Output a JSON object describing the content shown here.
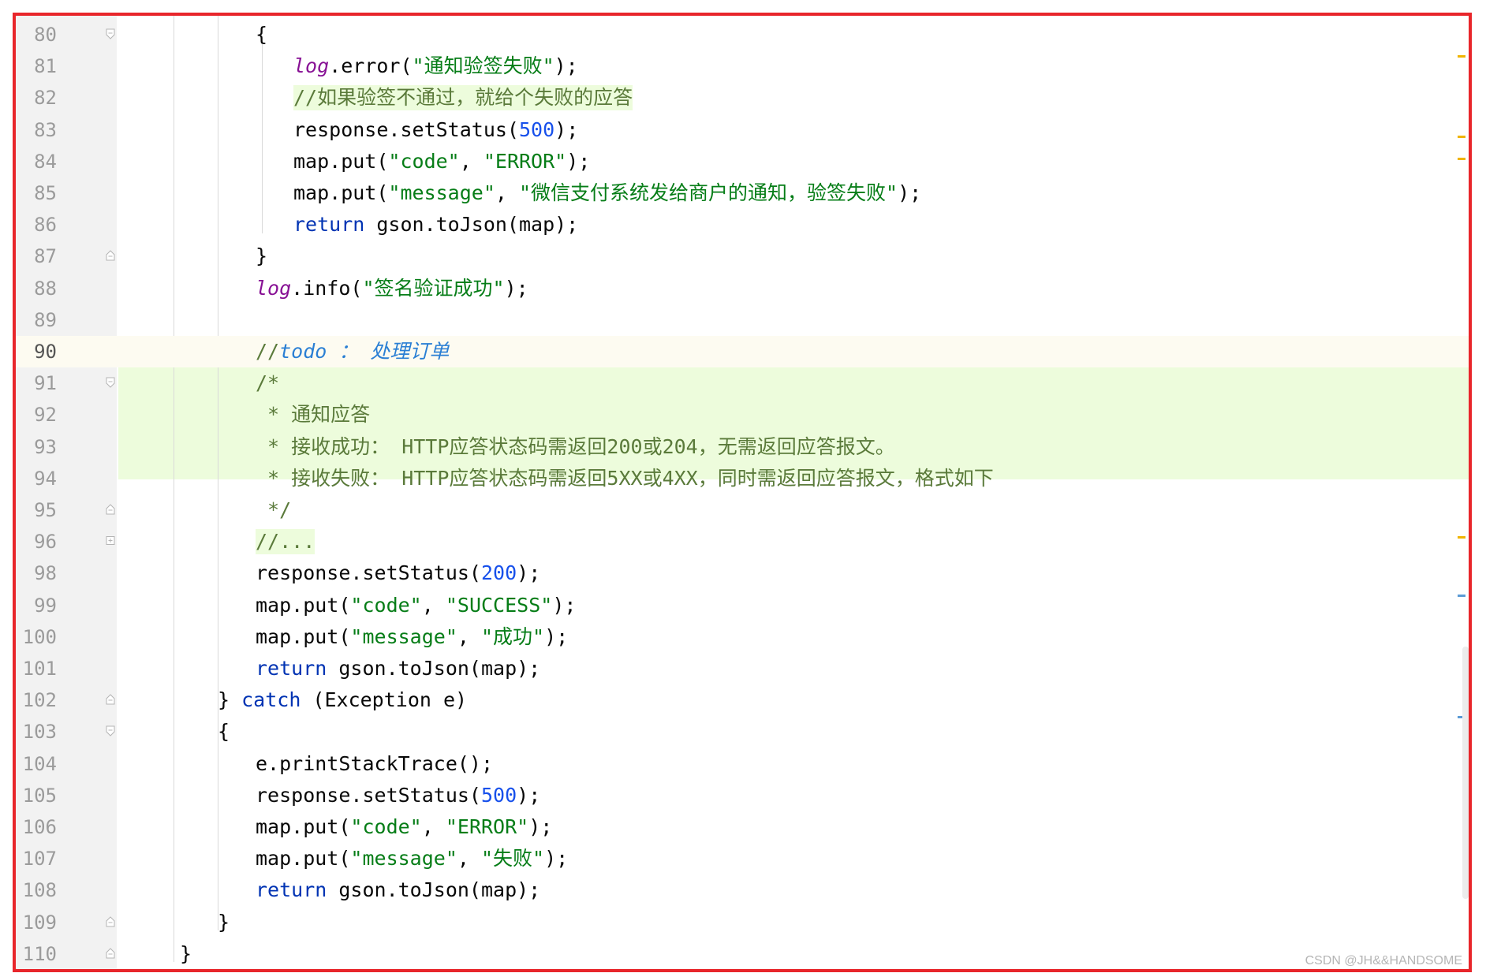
{
  "editor": {
    "lines": [
      {
        "num": "80",
        "fold": "open",
        "indent": 3,
        "tokens": [
          {
            "t": "{",
            "c": ""
          }
        ]
      },
      {
        "num": "81",
        "fold": "",
        "indent": 4,
        "tokens": [
          {
            "t": "log",
            "c": "logv"
          },
          {
            "t": ".error(",
            "c": ""
          },
          {
            "t": "\"通知验签失败\"",
            "c": "str"
          },
          {
            "t": ");",
            "c": ""
          }
        ]
      },
      {
        "num": "82",
        "fold": "",
        "indent": 4,
        "hl": true,
        "tokens": [
          {
            "t": "//如果验签不通过，就给个失败的应答",
            "c": "dcmt"
          }
        ]
      },
      {
        "num": "83",
        "fold": "",
        "indent": 4,
        "tokens": [
          {
            "t": "response.setStatus(",
            "c": ""
          },
          {
            "t": "500",
            "c": "num"
          },
          {
            "t": ");",
            "c": ""
          }
        ]
      },
      {
        "num": "84",
        "fold": "",
        "indent": 4,
        "tokens": [
          {
            "t": "map.put(",
            "c": ""
          },
          {
            "t": "\"code\"",
            "c": "str"
          },
          {
            "t": ", ",
            "c": ""
          },
          {
            "t": "\"ERROR\"",
            "c": "str"
          },
          {
            "t": ");",
            "c": ""
          }
        ]
      },
      {
        "num": "85",
        "fold": "",
        "indent": 4,
        "tokens": [
          {
            "t": "map.put(",
            "c": ""
          },
          {
            "t": "\"message\"",
            "c": "str"
          },
          {
            "t": ", ",
            "c": ""
          },
          {
            "t": "\"微信支付系统发给商户的通知，验签失败\"",
            "c": "str"
          },
          {
            "t": ");",
            "c": ""
          }
        ]
      },
      {
        "num": "86",
        "fold": "",
        "indent": 4,
        "tokens": [
          {
            "t": "return",
            "c": "kw"
          },
          {
            "t": " gson.toJson(map);",
            "c": ""
          }
        ]
      },
      {
        "num": "87",
        "fold": "close",
        "indent": 3,
        "tokens": [
          {
            "t": "}",
            "c": ""
          }
        ]
      },
      {
        "num": "88",
        "fold": "",
        "indent": 3,
        "tokens": [
          {
            "t": "log",
            "c": "logv"
          },
          {
            "t": ".info(",
            "c": ""
          },
          {
            "t": "\"签名验证成功\"",
            "c": "str"
          },
          {
            "t": ");",
            "c": ""
          }
        ]
      },
      {
        "num": "89",
        "fold": "",
        "indent": 3,
        "tokens": []
      },
      {
        "num": "90",
        "fold": "",
        "indent": 3,
        "current": true,
        "tokens": [
          {
            "t": "//",
            "c": "dcmt"
          },
          {
            "t": "todo ： 处理订单",
            "c": "todo"
          }
        ]
      },
      {
        "num": "91",
        "fold": "open",
        "indent": 3,
        "block": true,
        "tokens": [
          {
            "t": "/*",
            "c": "dcmt"
          }
        ]
      },
      {
        "num": "92",
        "fold": "",
        "indent": 3,
        "block": true,
        "tokens": [
          {
            "t": " * 通知应答",
            "c": "dcmt"
          }
        ]
      },
      {
        "num": "93",
        "fold": "",
        "indent": 3,
        "block": true,
        "tokens": [
          {
            "t": " * 接收成功： HTTP应答状态码需返回200或204，无需返回应答报文。",
            "c": "dcmt"
          }
        ]
      },
      {
        "num": "94",
        "fold": "",
        "indent": 3,
        "block": true,
        "tokens": [
          {
            "t": " * 接收失败： HTTP应答状态码需返回5XX或4XX，同时需返回应答报文，格式如下",
            "c": "dcmt"
          }
        ]
      },
      {
        "num": "95",
        "fold": "close",
        "indent": 3,
        "block": true,
        "tokens": [
          {
            "t": " */",
            "c": "dcmt"
          }
        ]
      },
      {
        "num": "96",
        "fold": "plus",
        "indent": 3,
        "hl": true,
        "tokens": [
          {
            "t": "//...",
            "c": "dcmt"
          }
        ]
      },
      {
        "num": "98",
        "fold": "",
        "indent": 3,
        "tokens": [
          {
            "t": "response.setStatus(",
            "c": ""
          },
          {
            "t": "200",
            "c": "num"
          },
          {
            "t": ");",
            "c": ""
          }
        ]
      },
      {
        "num": "99",
        "fold": "",
        "indent": 3,
        "tokens": [
          {
            "t": "map.put(",
            "c": ""
          },
          {
            "t": "\"code\"",
            "c": "str"
          },
          {
            "t": ", ",
            "c": ""
          },
          {
            "t": "\"SUCCESS\"",
            "c": "str"
          },
          {
            "t": ");",
            "c": ""
          }
        ]
      },
      {
        "num": "100",
        "fold": "",
        "indent": 3,
        "tokens": [
          {
            "t": "map.put(",
            "c": ""
          },
          {
            "t": "\"message\"",
            "c": "str"
          },
          {
            "t": ", ",
            "c": ""
          },
          {
            "t": "\"成功\"",
            "c": "str"
          },
          {
            "t": ");",
            "c": ""
          }
        ]
      },
      {
        "num": "101",
        "fold": "",
        "indent": 3,
        "tokens": [
          {
            "t": "return",
            "c": "kw"
          },
          {
            "t": " gson.toJson(map);",
            "c": ""
          }
        ]
      },
      {
        "num": "102",
        "fold": "close",
        "indent": 2,
        "tokens": [
          {
            "t": "} ",
            "c": ""
          },
          {
            "t": "catch",
            "c": "kw"
          },
          {
            "t": " (Exception e)",
            "c": ""
          }
        ]
      },
      {
        "num": "103",
        "fold": "open",
        "indent": 2,
        "tokens": [
          {
            "t": "{",
            "c": ""
          }
        ]
      },
      {
        "num": "104",
        "fold": "",
        "indent": 3,
        "tokens": [
          {
            "t": "e.printStackTrace();",
            "c": ""
          }
        ]
      },
      {
        "num": "105",
        "fold": "",
        "indent": 3,
        "tokens": [
          {
            "t": "response.setStatus(",
            "c": ""
          },
          {
            "t": "500",
            "c": "num"
          },
          {
            "t": ");",
            "c": ""
          }
        ]
      },
      {
        "num": "106",
        "fold": "",
        "indent": 3,
        "tokens": [
          {
            "t": "map.put(",
            "c": ""
          },
          {
            "t": "\"code\"",
            "c": "str"
          },
          {
            "t": ", ",
            "c": ""
          },
          {
            "t": "\"ERROR\"",
            "c": "str"
          },
          {
            "t": ");",
            "c": ""
          }
        ]
      },
      {
        "num": "107",
        "fold": "",
        "indent": 3,
        "tokens": [
          {
            "t": "map.put(",
            "c": ""
          },
          {
            "t": "\"message\"",
            "c": "str"
          },
          {
            "t": ", ",
            "c": ""
          },
          {
            "t": "\"失败\"",
            "c": "str"
          },
          {
            "t": ");",
            "c": ""
          }
        ]
      },
      {
        "num": "108",
        "fold": "",
        "indent": 3,
        "tokens": [
          {
            "t": "return",
            "c": "kw"
          },
          {
            "t": " gson.toJson(map);",
            "c": ""
          }
        ]
      },
      {
        "num": "109",
        "fold": "close",
        "indent": 2,
        "tokens": [
          {
            "t": "}",
            "c": ""
          }
        ]
      },
      {
        "num": "110",
        "fold": "close",
        "indent": 1,
        "tokens": [
          {
            "t": "}",
            "c": ""
          }
        ]
      }
    ]
  },
  "colors": {
    "frame_border": "#e8262b",
    "keyword": "#0033b3",
    "string": "#067d17",
    "number": "#1750eb",
    "log_field": "#871094",
    "comment_highlight": "#edfcdc",
    "todo": "#2a7fd4"
  },
  "watermark": "CSDN @JH&&HANDSOME"
}
